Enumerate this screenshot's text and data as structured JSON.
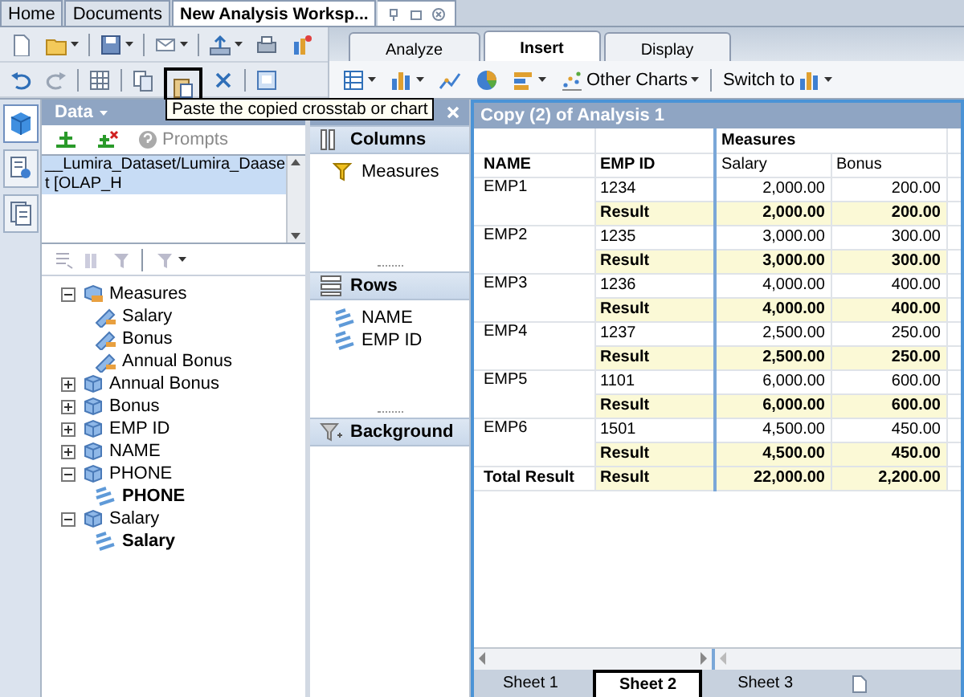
{
  "doc_tabs": [
    {
      "label": "Home",
      "selected": false
    },
    {
      "label": "Documents",
      "selected": false
    },
    {
      "label": "New Analysis Worksp...",
      "selected": true
    }
  ],
  "paste_button": {
    "tooltip": "Paste the copied crosstab or chart",
    "highlighted": true
  },
  "ribbon_tabs": [
    {
      "label": "Analyze",
      "selected": false
    },
    {
      "label": "Insert",
      "selected": true
    },
    {
      "label": "Display",
      "selected": false
    }
  ],
  "insert_toolbar": {
    "other_charts": "Other Charts",
    "switch_to": "Switch to"
  },
  "side_tabs": [
    {
      "kind": "data",
      "selected": true
    },
    {
      "kind": "properties",
      "selected": false
    },
    {
      "kind": "outline",
      "selected": false
    }
  ],
  "data_panel": {
    "title": "Data",
    "prompts": "Prompts",
    "sources": [
      {
        "label": "__Lumira_Dataset/Lumira_Daaset [OLAP_H",
        "selected": true
      }
    ],
    "tree": [
      {
        "label": "Measures",
        "kind": "measures",
        "expanded": true,
        "children": [
          {
            "label": "Salary",
            "kind": "measure"
          },
          {
            "label": "Bonus",
            "kind": "measure"
          },
          {
            "label": "Annual Bonus",
            "kind": "measure"
          }
        ]
      },
      {
        "label": "Annual Bonus",
        "kind": "dimension",
        "expanded": false
      },
      {
        "label": "Bonus",
        "kind": "dimension",
        "expanded": false
      },
      {
        "label": "EMP ID",
        "kind": "dimension",
        "expanded": false
      },
      {
        "label": "NAME",
        "kind": "dimension",
        "expanded": false
      },
      {
        "label": "PHONE",
        "kind": "dimension",
        "expanded": true,
        "children": [
          {
            "label": "PHONE",
            "kind": "hierarchy"
          }
        ]
      },
      {
        "label": "Salary",
        "kind": "dimension",
        "expanded": true,
        "children": [
          {
            "label": "Salary",
            "kind": "hierarchy"
          }
        ]
      }
    ]
  },
  "layout_panel": {
    "sections": [
      {
        "title": "Columns",
        "kind": "columns",
        "items": [
          {
            "label": "Measures",
            "kind": "measures"
          }
        ]
      },
      {
        "title": "Rows",
        "kind": "rows",
        "items": [
          {
            "label": "NAME",
            "kind": "dimension"
          },
          {
            "label": "EMP ID",
            "kind": "dimension"
          }
        ]
      },
      {
        "title": "Background",
        "kind": "background"
      }
    ]
  },
  "crosstab": {
    "title": "Copy (2) of Analysis 1",
    "row_headers": [
      "NAME",
      "EMP ID"
    ],
    "measures_header": "Measures",
    "columns": [
      "Salary",
      "Bonus"
    ],
    "rows": [
      {
        "name": "EMP1",
        "emp_id": "1234",
        "values": [
          "2,000.00",
          "200.00"
        ],
        "result_label": "Result",
        "result": [
          "2,000.00",
          "200.00"
        ]
      },
      {
        "name": "EMP2",
        "emp_id": "1235",
        "values": [
          "3,000.00",
          "300.00"
        ],
        "result_label": "Result",
        "result": [
          "3,000.00",
          "300.00"
        ]
      },
      {
        "name": "EMP3",
        "emp_id": "1236",
        "values": [
          "4,000.00",
          "400.00"
        ],
        "result_label": "Result",
        "result": [
          "4,000.00",
          "400.00"
        ]
      },
      {
        "name": "EMP4",
        "emp_id": "1237",
        "values": [
          "2,500.00",
          "250.00"
        ],
        "result_label": "Result",
        "result": [
          "2,500.00",
          "250.00"
        ]
      },
      {
        "name": "EMP5",
        "emp_id": "1101",
        "values": [
          "6,000.00",
          "600.00"
        ],
        "result_label": "Result",
        "result": [
          "6,000.00",
          "600.00"
        ]
      },
      {
        "name": "EMP6",
        "emp_id": "1501",
        "values": [
          "4,500.00",
          "450.00"
        ],
        "result_label": "Result",
        "result": [
          "4,500.00",
          "450.00"
        ]
      }
    ],
    "total": {
      "name": "Total Result",
      "label": "Result",
      "values": [
        "22,000.00",
        "2,200.00"
      ]
    }
  },
  "sheets": [
    {
      "label": "Sheet 1",
      "selected": false,
      "highlighted": false
    },
    {
      "label": "Sheet 2",
      "selected": true,
      "highlighted": true
    },
    {
      "label": "Sheet 3",
      "selected": false,
      "highlighted": false
    }
  ]
}
